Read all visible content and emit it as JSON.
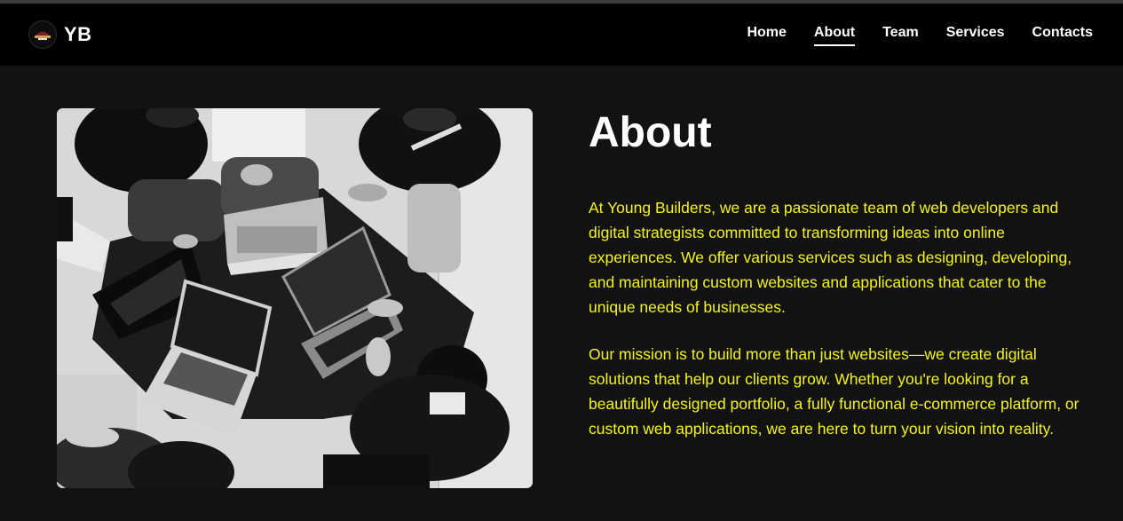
{
  "brand": {
    "name": "YB",
    "logo_icon": "yb-logo-icon"
  },
  "nav": {
    "items": [
      {
        "label": "Home",
        "active": false
      },
      {
        "label": "About",
        "active": true
      },
      {
        "label": "Team",
        "active": false
      },
      {
        "label": "Services",
        "active": false
      },
      {
        "label": "Contacts",
        "active": false
      }
    ]
  },
  "about": {
    "title": "About",
    "paragraph1": "At Young Builders, we are a passionate team of web developers and digital strategists committed to transforming ideas into online experiences. We offer various services such as designing, developing, and maintaining custom websites and applications that cater to the unique needs of businesses.",
    "paragraph2": "Our mission is to build more than just websites—we create digital solutions that help our clients grow. Whether you're looking for a beautifully designed portfolio, a fully functional e-commerce platform, or custom web applications, we are here to turn your vision into reality."
  },
  "colors": {
    "page_background": "#121212",
    "navbar_background": "#000000",
    "text_accent": "#f4f51b",
    "title_color": "#ffffff"
  }
}
